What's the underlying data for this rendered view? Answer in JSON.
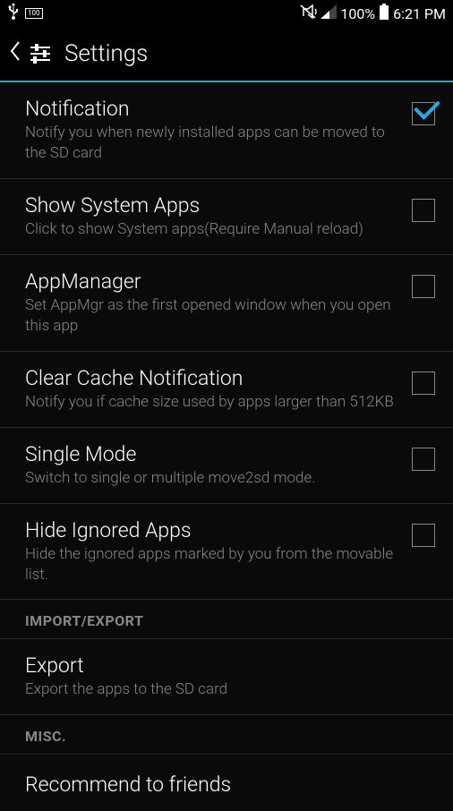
{
  "status_bar": {
    "battery_text": "100",
    "percent": "100%",
    "time": "6:21 PM"
  },
  "header": {
    "title": "Settings"
  },
  "settings": [
    {
      "title": "Notification",
      "subtitle": "Notify you when newly installed apps can be moved to the SD card",
      "checked": true
    },
    {
      "title": "Show System Apps",
      "subtitle": "Click to show System apps(Require Manual reload)",
      "checked": false
    },
    {
      "title": "AppManager",
      "subtitle": "Set AppMgr as the first opened window when you open this app",
      "checked": false
    },
    {
      "title": "Clear Cache Notification",
      "subtitle": "Notify you if cache size used by apps larger than 512KB",
      "checked": false
    },
    {
      "title": "Single Mode",
      "subtitle": "Switch to single or multiple move2sd mode.",
      "checked": false
    },
    {
      "title": "Hide Ignored Apps",
      "subtitle": "Hide the ignored apps marked by you from the movable list.",
      "checked": false
    }
  ],
  "sections": {
    "import_export": "IMPORT/EXPORT",
    "misc": "MISC."
  },
  "export_item": {
    "title": "Export",
    "subtitle": "Export the apps to the SD card"
  },
  "recommend": {
    "title": "Recommend to friends"
  }
}
